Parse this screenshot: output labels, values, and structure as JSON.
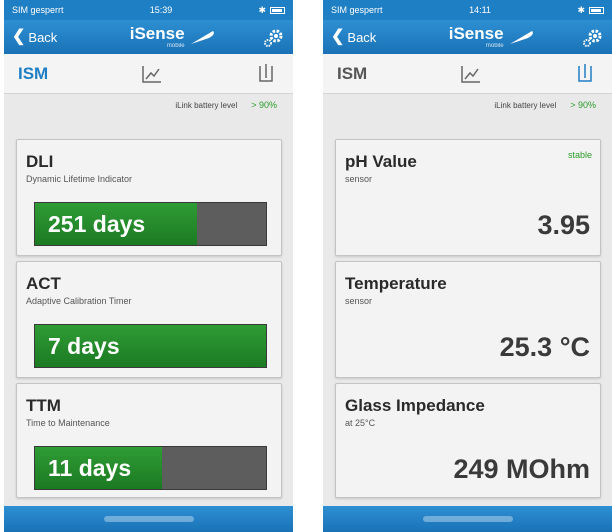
{
  "left": {
    "status": {
      "carrier": "SIM gesperrt",
      "time": "15:39"
    },
    "nav": {
      "back_label": "Back",
      "brand": "iSense",
      "brand_sub": "mobile"
    },
    "tabs": {
      "ism_label": "ISM"
    },
    "battery": {
      "label": "iLink battery level",
      "value": "> 90%"
    },
    "cards": [
      {
        "title": "DLI",
        "subtitle": "Dynamic Lifetime Indicator",
        "value_label": "251 days",
        "fill_fraction": 0.7
      },
      {
        "title": "ACT",
        "subtitle": "Adaptive Calibration Timer",
        "value_label": "7 days",
        "fill_fraction": 1.0
      },
      {
        "title": "TTM",
        "subtitle": "Time to Maintenance",
        "value_label": "11 days",
        "fill_fraction": 0.55
      }
    ]
  },
  "right": {
    "status": {
      "carrier": "SIM gesperrt",
      "time": "14:11"
    },
    "nav": {
      "back_label": "Back",
      "brand": "iSense",
      "brand_sub": "mobile"
    },
    "tabs": {
      "ism_label": "ISM"
    },
    "battery": {
      "label": "iLink battery level",
      "value": "> 90%"
    },
    "cards": [
      {
        "title": "pH Value",
        "subtitle": "sensor",
        "state": "stable",
        "value": "3.95"
      },
      {
        "title": "Temperature",
        "subtitle": "sensor",
        "value": "25.3 °C"
      },
      {
        "title": "Glass Impedance",
        "subtitle": "at 25°C",
        "value": "249 MOhm"
      }
    ]
  },
  "colors": {
    "brand_blue": "#1f7fc4",
    "gauge_green": "#2a9b2a",
    "gauge_track": "#5d5d5d"
  },
  "icons": [
    "back-chevron-icon",
    "feather-icon",
    "gear-icon",
    "chart-icon",
    "beaker-icon",
    "wifi-icon",
    "bluetooth-icon",
    "battery-icon"
  ]
}
